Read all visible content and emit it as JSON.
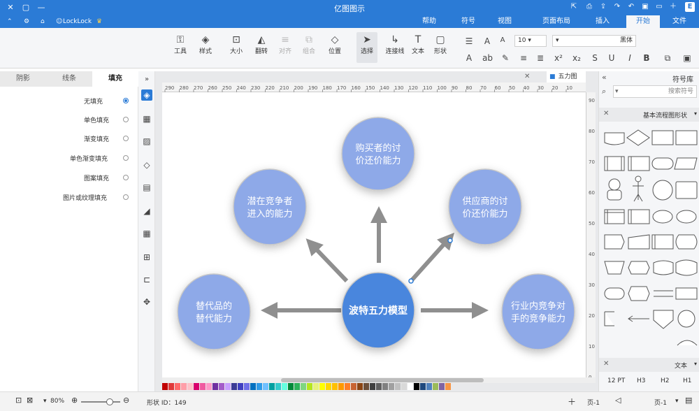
{
  "window": {
    "title": "亿图图示",
    "controls": [
      "close-icon",
      "maximize-icon",
      "minimize-icon"
    ],
    "quick_icons": [
      "share-icon",
      "print-icon",
      "export-icon",
      "redo-icon",
      "undo-icon",
      "save-icon",
      "open-icon",
      "new-icon",
      "app-logo-icon"
    ]
  },
  "menu": {
    "tabs": [
      "文件",
      "开始",
      "插入",
      "页面布局",
      "视图",
      "符号",
      "帮助"
    ],
    "active": "开始",
    "user": "LockLock",
    "user_icons": [
      "settings-icon",
      "home-icon",
      "crown-icon",
      "user-icon",
      "up-icon"
    ]
  },
  "ribbon": {
    "tool_label": "工具",
    "style_label": "样式",
    "size_label": "大小",
    "flip_label": "翻转",
    "align_label": "对齐",
    "group_label": "组合",
    "position_label": "位置",
    "select_label": "选择",
    "connector_label": "连接线",
    "text_label": "文本",
    "shape_label": "形状",
    "font_size": "10",
    "font_name": "黑体",
    "format_icons": [
      "bold-icon",
      "italic-icon",
      "underline-icon",
      "strikethrough-icon",
      "superscript-icon",
      "subscript-icon",
      "font-color-icon",
      "font-grow-icon",
      "font-shrink-icon",
      "align-icon",
      "list-icon",
      "highlight-icon",
      "case-icon"
    ]
  },
  "left_panel": {
    "tabs": [
      "填充",
      "线条",
      "阴影"
    ],
    "active_tab": "填充",
    "options": [
      "无填充",
      "单色填充",
      "渐变填充",
      "单色渐变填充",
      "图案填充",
      "图片或纹理填充"
    ],
    "selected": "无填充"
  },
  "side_icons": [
    "fill-icon",
    "grid-icon",
    "image-icon",
    "layers-icon",
    "page-icon",
    "chart-icon",
    "table-icon",
    "export-icon",
    "outline-icon",
    "fit-icon"
  ],
  "canvas": {
    "doc_tab": "五力图",
    "ruler_labels": [
      "290",
      "280",
      "270",
      "260",
      "250",
      "240",
      "230",
      "220",
      "210",
      "200",
      "190",
      "180",
      "170",
      "160",
      "150",
      "140",
      "130",
      "120",
      "110",
      "100",
      "90",
      "80",
      "70",
      "60",
      "50",
      "40",
      "30",
      "20",
      "10"
    ],
    "vruler_labels": [
      "90",
      "80",
      "70",
      "60",
      "50",
      "40",
      "30",
      "20",
      "10",
      "0"
    ],
    "center": "波特五力模型",
    "nodes": {
      "top": "购买者的讨价还价能力",
      "upper_left": "潜在竞争者进入的能力",
      "upper_right": "供应商的讨价还价能力",
      "lower_left": "替代品的替代能力",
      "lower_right": "行业内竞争对手的竞争能力"
    },
    "colors": {
      "center": "#4a86dd",
      "outer": "#8ea9e8",
      "arrow": "#8f8f8f"
    }
  },
  "right_panel": {
    "title": "符号库",
    "search_placeholder": "搜索符号",
    "library": "基本流程图形状",
    "text_section": "文本",
    "text_styles": [
      "H1",
      "H2",
      "H3",
      "12 PT"
    ]
  },
  "status": {
    "page_label": "页-1",
    "page_nav": "页-1",
    "shape_id": "形状 ID：149",
    "zoom": "80%",
    "icons": [
      "fullscreen-icon",
      "fit-page-icon",
      "zoom-out-icon",
      "zoom-in-icon",
      "add-page-icon",
      "page-settings-icon"
    ]
  },
  "palette_colors": [
    "#c00000",
    "#e03a3a",
    "#ff6b6b",
    "#ff9ea8",
    "#ffc2c8",
    "#d9006c",
    "#f05aa0",
    "#ff99c8",
    "#7030a0",
    "#a35cc9",
    "#c9a0ff",
    "#3c3c96",
    "#4040c0",
    "#6f6fe8",
    "#0070c0",
    "#2e9be8",
    "#6fc0ff",
    "#00a0a0",
    "#33cccc",
    "#66ffe0",
    "#008a3a",
    "#2db35a",
    "#7fd67f",
    "#b5e61d",
    "#e6f27a",
    "#ffff00",
    "#ffd700",
    "#ffc000",
    "#ff9900",
    "#ff7f27",
    "#c86432",
    "#8b4513",
    "#6b4f3a",
    "#404040",
    "#606060",
    "#808080",
    "#a0a0a0",
    "#c0c0c0",
    "#d9d9d9",
    "#ffffff",
    "#000000",
    "#1f497d",
    "#4f81bd",
    "#9bbb59",
    "#8064a2",
    "#f79646"
  ]
}
